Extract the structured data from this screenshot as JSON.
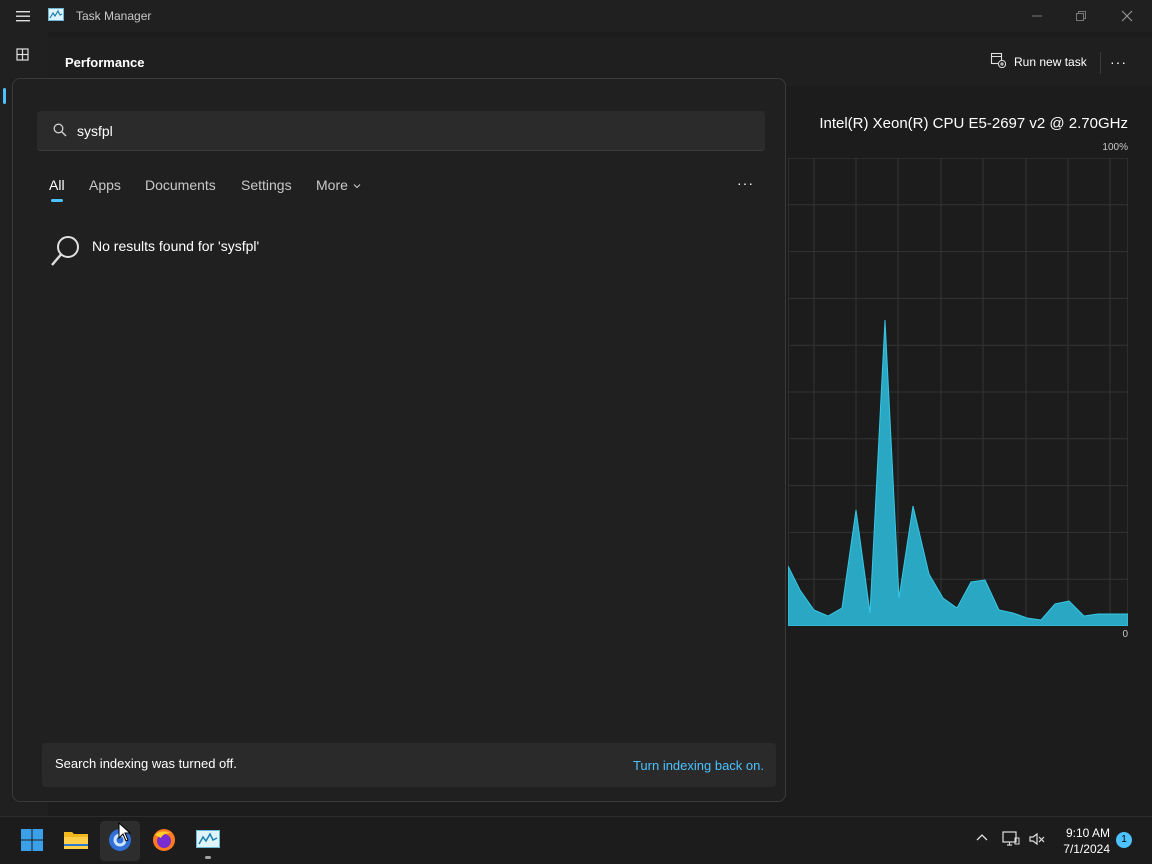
{
  "window": {
    "title": "Task Manager",
    "page_title": "Performance",
    "run_new_task": "Run new task",
    "more": "···"
  },
  "performance": {
    "cpu_name": "Intel(R) Xeon(R) CPU E5-2697 v2 @ 2.70GHz",
    "scale_max": "100%",
    "scale_min": "0"
  },
  "search": {
    "query": "sysfpl",
    "filters": [
      "All",
      "Apps",
      "Documents",
      "Settings",
      "More"
    ],
    "active_filter": "All",
    "more_options": "···",
    "no_results": "No results found for 'sysfpl'",
    "indexing_message": "Search indexing was turned off.",
    "indexing_link": "Turn indexing back on."
  },
  "taskbar": {
    "time": "9:10 AM",
    "date": "7/1/2024",
    "notification_count": "1"
  },
  "colors": {
    "accent": "#4cc2ff",
    "graph_fill": "#2aa7c3",
    "graph_line": "#35c8e6"
  }
}
